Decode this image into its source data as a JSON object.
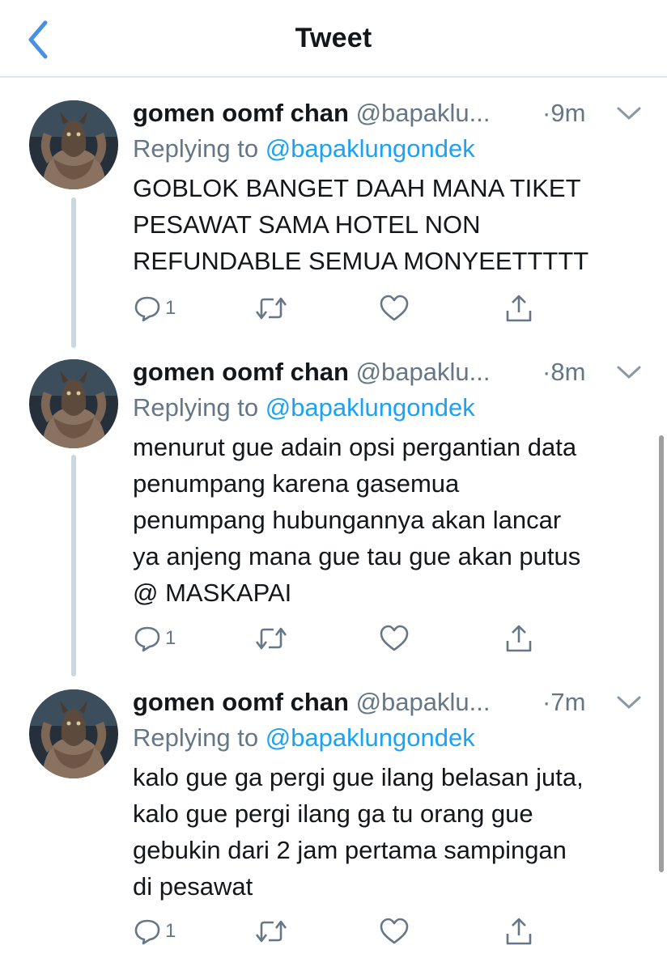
{
  "header": {
    "title": "Tweet",
    "back_icon": "chevron-left-icon"
  },
  "colors": {
    "accent": "#1da1f2",
    "back_icon": "#4a90e2",
    "secondary_text": "#657786",
    "thread_line": "#ccd6dd",
    "divider": "#e1e8ed"
  },
  "tweets": [
    {
      "display_name": "gomen oomf chan",
      "handle": "@bapaklu...",
      "time": "·9m",
      "replying_prefix": "Replying to ",
      "replying_handle": "@bapaklungondek",
      "lines": [
        "GOBLOK BANGET DAAH MANA TIKET",
        "PESAWAT SAMA HOTEL NON",
        "REFUNDABLE SEMUA MONYEETTTTT"
      ],
      "reply_count": "1"
    },
    {
      "display_name": "gomen oomf chan",
      "handle": "@bapaklu...",
      "time": "·8m",
      "replying_prefix": "Replying to ",
      "replying_handle": "@bapaklungondek",
      "lines": [
        "menurut gue adain opsi pergantian data",
        "penumpang karena gasemua",
        "penumpang hubungannya akan lancar",
        "ya anjeng mana gue tau gue akan putus",
        "@ MASKAPAI"
      ],
      "reply_count": "1"
    },
    {
      "display_name": "gomen oomf chan",
      "handle": "@bapaklu...",
      "time": "·7m",
      "replying_prefix": "Replying to ",
      "replying_handle": "@bapaklungondek",
      "lines": [
        "kalo gue ga pergi gue ilang belasan juta,",
        "kalo gue pergi ilang ga tu orang gue",
        "gebukin dari 2 jam pertama sampingan",
        "di pesawat"
      ],
      "reply_count": "1"
    }
  ],
  "action_icons": [
    "reply-icon",
    "retweet-icon",
    "like-icon",
    "share-icon"
  ]
}
